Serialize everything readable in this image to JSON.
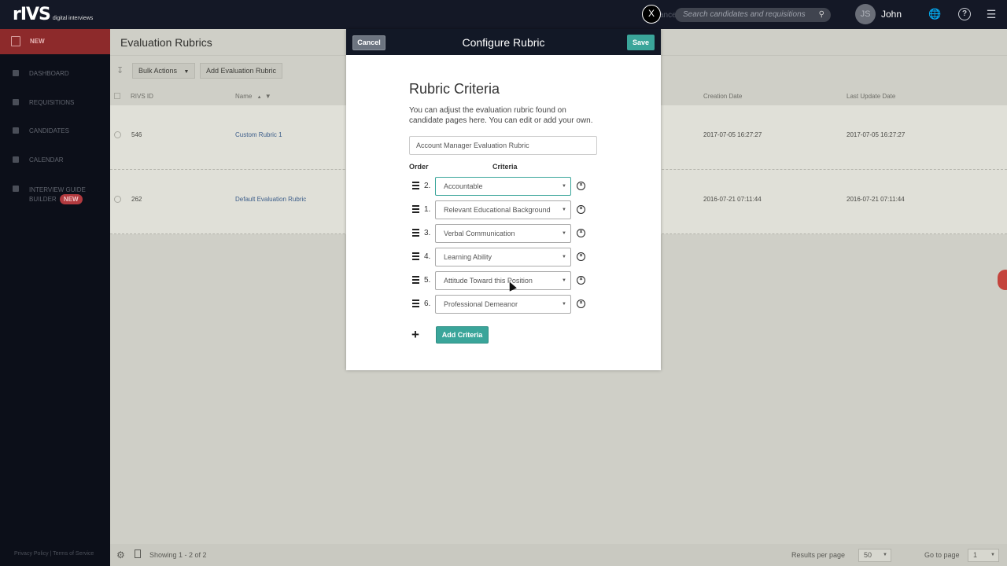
{
  "topbar": {
    "logo": "rIVS",
    "logo_tagline": "digital interviews",
    "close_label": "X",
    "advanced_label": "anced",
    "search_placeholder": "Search candidates and requisitions",
    "avatar_initials": "JS",
    "username": "John",
    "icons": [
      "globe-icon",
      "help-icon",
      "menu-icon"
    ]
  },
  "sidebar": {
    "new_label": "NEW",
    "items": [
      {
        "label": "DASHBOARD",
        "icon": "chart-icon"
      },
      {
        "label": "REQUISITIONS",
        "icon": "folder-icon"
      },
      {
        "label": "CANDIDATES",
        "icon": "person-icon"
      },
      {
        "label": "CALENDAR",
        "icon": "calendar-icon"
      },
      {
        "label": "INTERVIEW GUIDE",
        "label2": "BUILDER",
        "badge": "NEW",
        "icon": "guide-icon"
      }
    ],
    "footer": "Privacy Policy | Terms of Service"
  },
  "main": {
    "title": "Evaluation Rubrics",
    "bulk_actions": "Bulk Actions",
    "add_rubric": "Add Evaluation Rubric",
    "columns": {
      "id": "RIVS ID",
      "name": "Name",
      "created": "Creation Date",
      "updated": "Last Update Date"
    },
    "rows": [
      {
        "id": "546",
        "name": "Custom Rubric 1",
        "created": "2017-07-05 16:27:27",
        "updated": "2017-07-05 16:27:27"
      },
      {
        "id": "262",
        "name": "Default Evaluation Rubric",
        "created": "2016-07-21 07:11:44",
        "updated": "2016-07-21 07:11:44"
      }
    ],
    "footer": {
      "showing": "Showing 1 - 2 of 2",
      "results_label": "Results per page",
      "results_value": "50",
      "goto_label": "Go to page",
      "goto_value": "1"
    }
  },
  "modal": {
    "title": "Configure Rubric",
    "cancel": "Cancel",
    "save": "Save",
    "heading": "Rubric Criteria",
    "description": "You can adjust the evaluation rubric found on candidate pages here. You can edit or add your own.",
    "rubric_name": "Account Manager Evaluation Rubric",
    "order_header": "Order",
    "criteria_header": "Criteria",
    "criteria": [
      {
        "order": "2.",
        "value": "Accountable"
      },
      {
        "order": "1.",
        "value": "Relevant Educational Background"
      },
      {
        "order": "3.",
        "value": "Verbal Communication"
      },
      {
        "order": "4.",
        "value": "Learning Ability"
      },
      {
        "order": "5.",
        "value": "Attitude Toward this Position"
      },
      {
        "order": "6.",
        "value": "Professional Demeanor"
      }
    ],
    "add_symbol": "+",
    "add_criteria": "Add Criteria"
  },
  "colors": {
    "topbar": "#141826",
    "sidebar": "#0c0f19",
    "new_button": "#8d2a2b",
    "accent_teal": "#3aa59a",
    "overlay_content": "#cfcfc7"
  }
}
